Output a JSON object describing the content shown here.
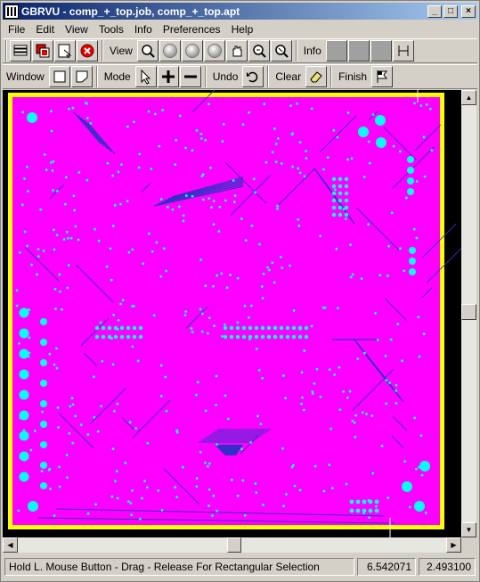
{
  "window": {
    "title": "GBRVU - comp_+_top.job, comp_+_top.apt",
    "min_label": "_",
    "max_label": "□",
    "close_label": "×"
  },
  "menu": [
    "File",
    "Edit",
    "View",
    "Tools",
    "Info",
    "Preferences",
    "Help"
  ],
  "toolbar1": {
    "view_label": "View",
    "info_label": "Info"
  },
  "toolbar2": {
    "window_label": "Window",
    "mode_label": "Mode",
    "undo_label": "Undo",
    "clear_label": "Clear",
    "finish_label": "Finish"
  },
  "status": {
    "message": "Hold L. Mouse Button - Drag - Release For Rectangular Selection",
    "x_coord": "6.542071",
    "y_coord": "2.493100"
  },
  "colors": {
    "board": "#ff00ff",
    "outline": "#ffff00",
    "pads": "#00ffff",
    "traces": "#3030c8",
    "background": "#000000"
  }
}
